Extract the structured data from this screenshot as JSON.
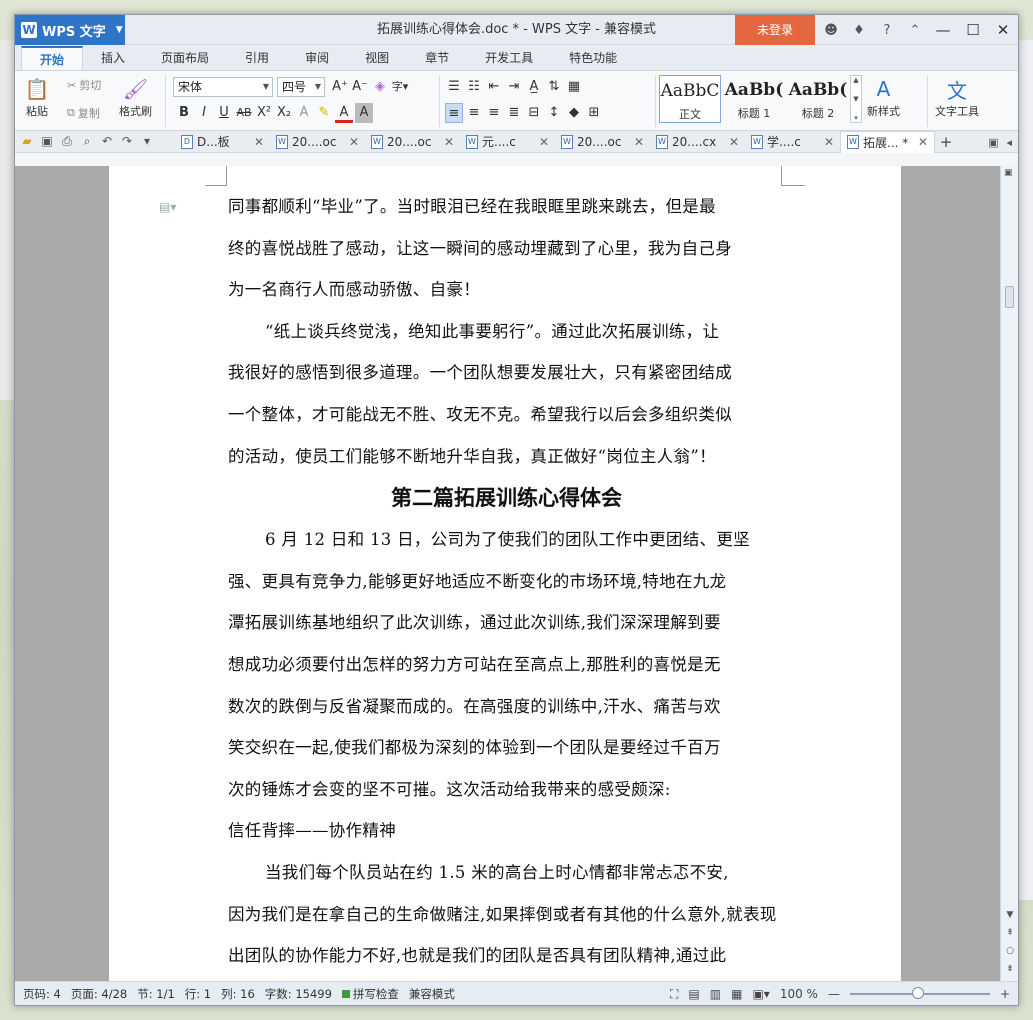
{
  "window": {
    "app_name": "WPS 文字",
    "app_logo": "W",
    "title": "拓展训练心得体会.doc * - WPS 文字 - 兼容模式",
    "login_label": "未登录",
    "title_icons": [
      "☻",
      "♦",
      "?",
      "⌃"
    ],
    "controls": [
      "—",
      "☐",
      "✕"
    ]
  },
  "ribbon_tabs": [
    "开始",
    "插入",
    "页面布局",
    "引用",
    "审阅",
    "视图",
    "章节",
    "开发工具",
    "特色功能"
  ],
  "ribbon": {
    "paste": "粘贴",
    "cut": "剪切",
    "copy": "复制",
    "format_painter": "格式刷",
    "font_name": "宋体",
    "font_size": "四号",
    "styles": [
      {
        "sample": "AaBbC",
        "label": "正文"
      },
      {
        "sample": "AaBb(",
        "label": "标题 1"
      },
      {
        "sample": "AaBb(",
        "label": "标题 2"
      }
    ],
    "new_style": "新样式",
    "text_tools": "文字工具"
  },
  "doc_tabs": [
    {
      "label": "D...板",
      "active": false
    },
    {
      "label": "20....oc",
      "active": false
    },
    {
      "label": "20....oc",
      "active": false
    },
    {
      "label": "元....c",
      "active": false
    },
    {
      "label": "20....oc",
      "active": false
    },
    {
      "label": "20....cx",
      "active": false
    },
    {
      "label": "学....c",
      "active": false
    },
    {
      "label": "拓展... *",
      "active": true
    }
  ],
  "document": {
    "lines": [
      {
        "text": "同事都顺利“毕业”了。当时眼泪已经在我眼眶里跳来跳去，但是最",
        "indent": false
      },
      {
        "text": "终的喜悦战胜了感动，让这一瞬间的感动埋藏到了心里，我为自己身",
        "indent": false
      },
      {
        "text": "为一名商行人而感动骄傲、自豪！",
        "indent": false
      },
      {
        "text": "“纸上谈兵终觉浅，绝知此事要躬行”。通过此次拓展训练，让",
        "indent": true
      },
      {
        "text": "我很好的感悟到很多道理。一个团队想要发展壮大，只有紧密团结成",
        "indent": false
      },
      {
        "text": "一个整体，才可能战无不胜、攻无不克。希望我行以后会多组织类似",
        "indent": false
      },
      {
        "text": "的活动，使员工们能够不断地升华自我，真正做好“岗位主人翁”！",
        "indent": false
      }
    ],
    "heading": "第二篇拓展训练心得体会",
    "lines2": [
      {
        "text": "6 月 12 日和 13 日，公司为了使我们的团队工作中更团结、更坚",
        "indent": true
      },
      {
        "text": "强、更具有竞争力,能够更好地适应不断变化的市场环境,特地在九龙",
        "indent": false
      },
      {
        "text": "潭拓展训练基地组织了此次训练，通过此次训练,我们深深理解到要",
        "indent": false
      },
      {
        "text": "想成功必须要付出怎样的努力方可站在至高点上,那胜利的喜悦是无",
        "indent": false
      },
      {
        "text": "数次的跌倒与反省凝聚而成的。在高强度的训练中,汗水、痛苦与欢",
        "indent": false
      },
      {
        "text": "笑交织在一起,使我们都极为深刻的体验到一个团队是要经过千百万",
        "indent": false
      },
      {
        "text": "次的锤炼才会变的坚不可摧。这次活动给我带来的感受颇深:",
        "indent": false
      },
      {
        "text": "信任背摔——协作精神",
        "indent": false
      },
      {
        "text": "当我们每个队员站在约 1.5 米的高台上时心情都非常忐忑不安,",
        "indent": true
      },
      {
        "text": "因为我们是在拿自己的生命做赌注,如果摔倒或者有其他的什么意外,就表现",
        "indent": false
      },
      {
        "text": "出团队的协作能力不好,也就是我们的团队是否具有团队精神,通过此",
        "indent": false
      }
    ]
  },
  "status": {
    "page_code": "页码: 4",
    "page": "页面: 4/28",
    "section": "节: 1/1",
    "row": "行: 1",
    "col": "列: 16",
    "words": "字数: 15499",
    "spell": "拼写检查",
    "compat": "兼容模式",
    "zoom": "100 %"
  },
  "colors": {
    "accent": "#2f74c7",
    "login": "#e5673f"
  }
}
